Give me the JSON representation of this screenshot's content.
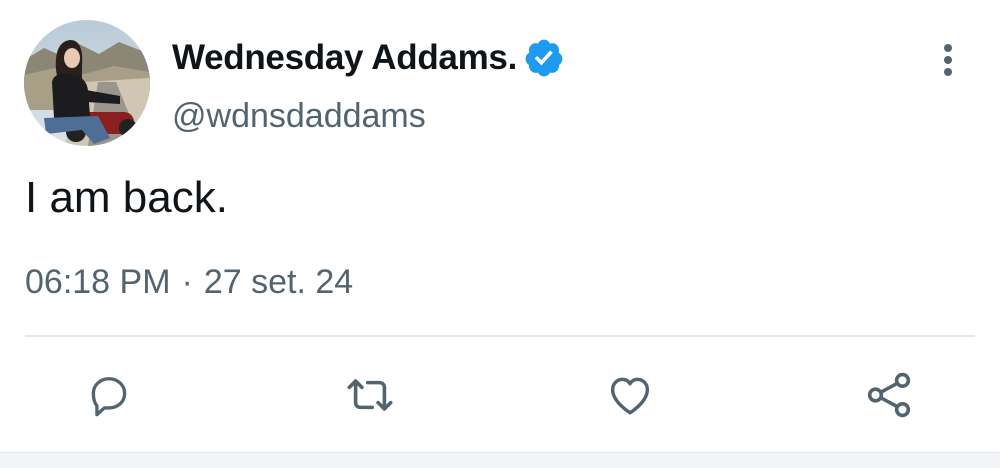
{
  "tweet": {
    "display_name": "Wednesday Addams.",
    "handle": "@wdnsdaddams",
    "text": "I am back.",
    "time": "06:18 PM",
    "separator": "·",
    "date": "27 set. 24",
    "verified": true
  },
  "icons": {
    "verified": "verified-badge-icon",
    "more": "more-vertical-icon",
    "reply": "reply-icon",
    "retweet": "retweet-icon",
    "like": "heart-icon",
    "share": "share-icon",
    "avatar": "avatar-photo"
  },
  "colors": {
    "text_primary": "#0f1419",
    "text_secondary": "#536471",
    "verified_blue": "#1d9bf0",
    "icon_gray": "#536471"
  }
}
